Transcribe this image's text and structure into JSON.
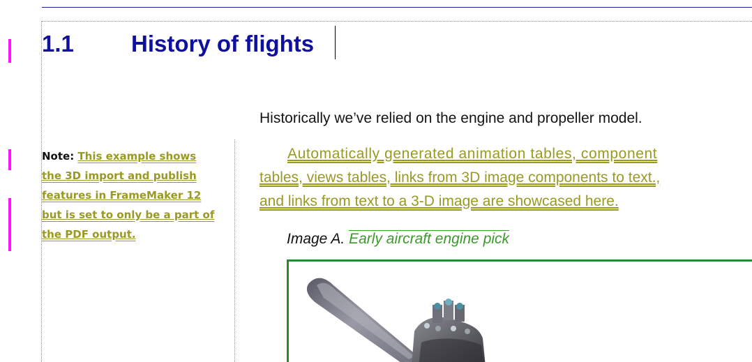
{
  "heading": {
    "number": "1.1",
    "title": "History of flights"
  },
  "intro": "Historically we’ve relied on the engine and propeller model.",
  "linked_paragraph": {
    "lines": [
      "Automatically generated animation tables, component",
      "tables, views tables, links from 3D image components to text.,",
      "and links from text to a 3-D image are showcased here."
    ]
  },
  "note": {
    "label": "Note:",
    "lines": [
      "This example shows",
      "the 3D import and publish",
      "features in FrameMaker 12",
      "but is set to only be a part of",
      "the PDF output."
    ]
  },
  "figure": {
    "caption_label": "Image A.",
    "caption_text": "Early aircraft engine pick",
    "image_icon": "propeller-engine-3d-image"
  },
  "colors": {
    "heading": "#10109e",
    "link_text": "#999924",
    "caption_text": "#3a9a2a",
    "change_bar": "#ff14ff",
    "image_border": "#2a8a2a",
    "top_rule": "#1b1bb0"
  }
}
